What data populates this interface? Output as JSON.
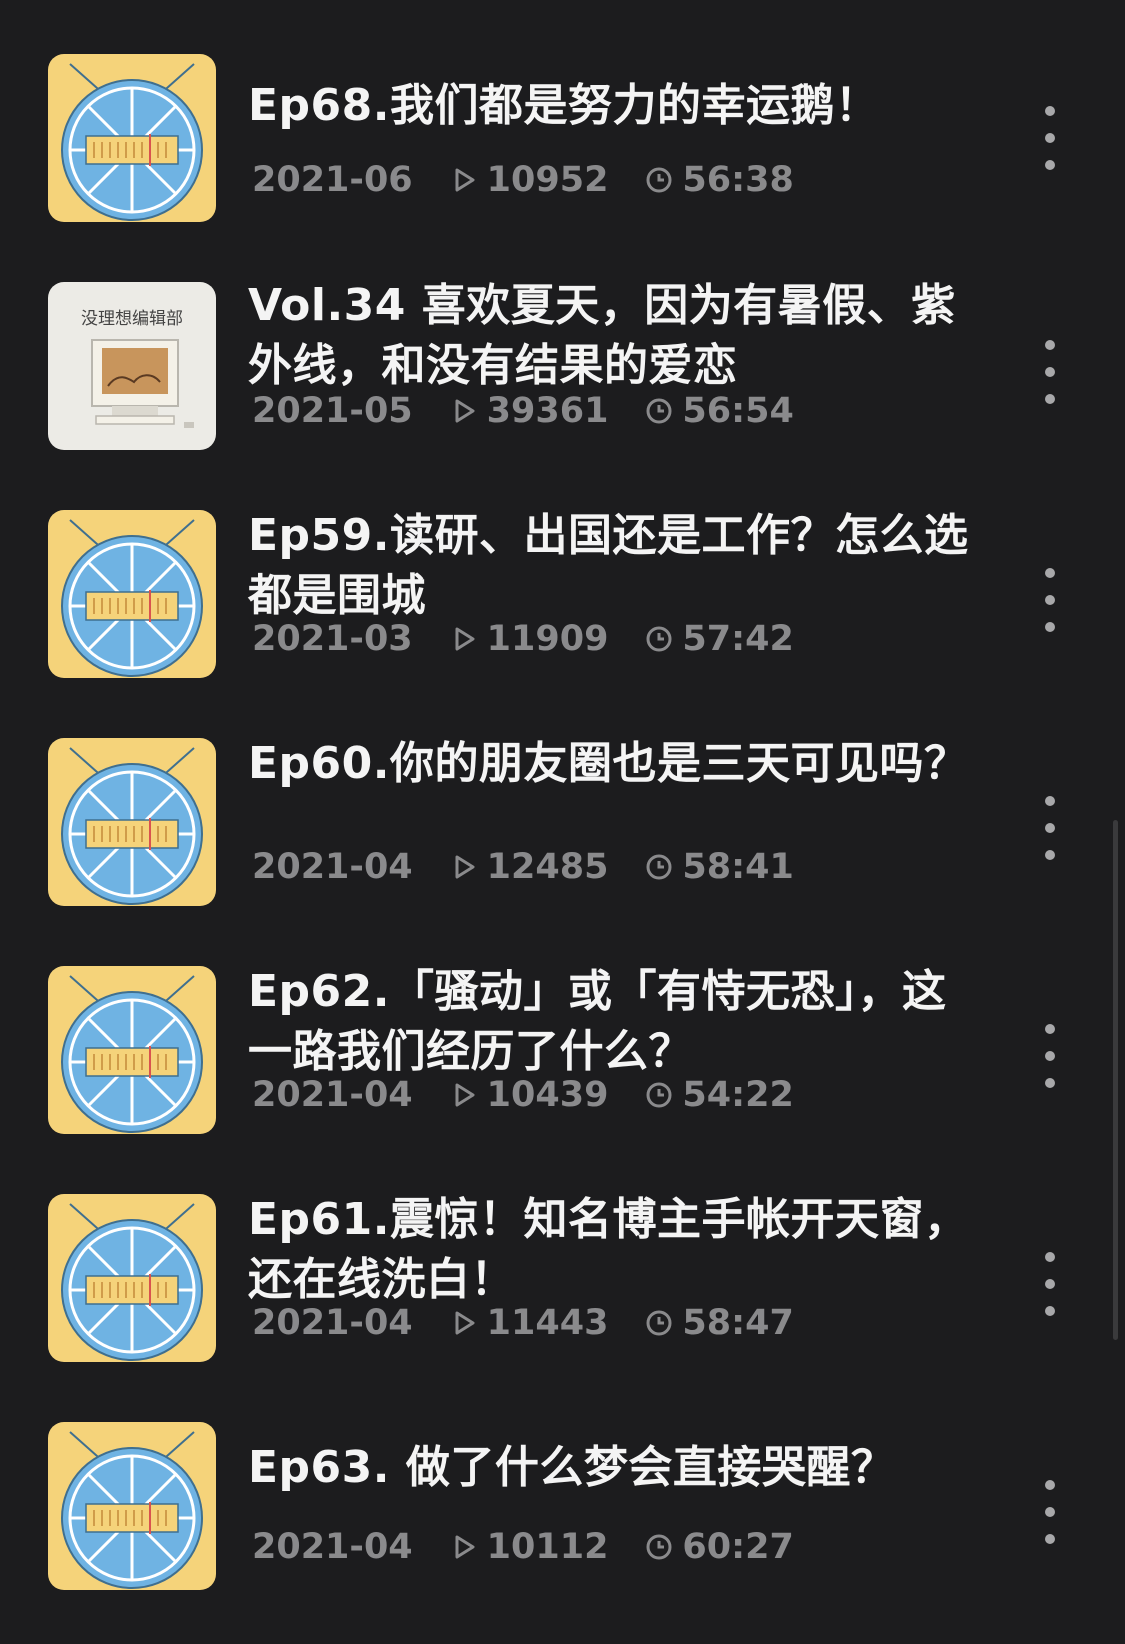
{
  "colors": {
    "background": "#1c1c1e",
    "title": "#f4f4f4",
    "meta": "#8a8a8c",
    "cover_yellow": "#f5d37a",
    "cover_blue": "#6fb3e3"
  },
  "episodes": [
    {
      "title": "Ep68.我们都是努力的幸运鹅！",
      "date": "2021-06",
      "plays": "10952",
      "duration": "56:38",
      "cover": "orange-tv-cover",
      "more_icon": "more-vertical-icon"
    },
    {
      "title": "Vol.34 喜欢夏天，因为有暑假、紫外线，和没有结果的爱恋",
      "date": "2021-05",
      "plays": "39361",
      "duration": "56:54",
      "cover": "computer-cover",
      "cover_text": "没理想编辑部",
      "more_icon": "more-vertical-icon"
    },
    {
      "title": "Ep59.读研、出国还是工作？怎么选都是围城",
      "date": "2021-03",
      "plays": "11909",
      "duration": "57:42",
      "cover": "orange-tv-cover",
      "more_icon": "more-vertical-icon"
    },
    {
      "title": "Ep60.你的朋友圈也是三天可见吗？",
      "date": "2021-04",
      "plays": "12485",
      "duration": "58:41",
      "cover": "orange-tv-cover",
      "more_icon": "more-vertical-icon"
    },
    {
      "title": "Ep62.「骚动」或「有恃无恐」，这一路我们经历了什么？",
      "date": "2021-04",
      "plays": "10439",
      "duration": "54:22",
      "cover": "orange-tv-cover",
      "more_icon": "more-vertical-icon"
    },
    {
      "title": "Ep61.震惊！知名博主手帐开天窗，还在线洗白！",
      "date": "2021-04",
      "plays": "11443",
      "duration": "58:47",
      "cover": "orange-tv-cover",
      "more_icon": "more-vertical-icon"
    },
    {
      "title": "Ep63. 做了什么梦会直接哭醒？",
      "date": "2021-04",
      "plays": "10112",
      "duration": "60:27",
      "cover": "orange-tv-cover",
      "more_icon": "more-vertical-icon"
    }
  ]
}
